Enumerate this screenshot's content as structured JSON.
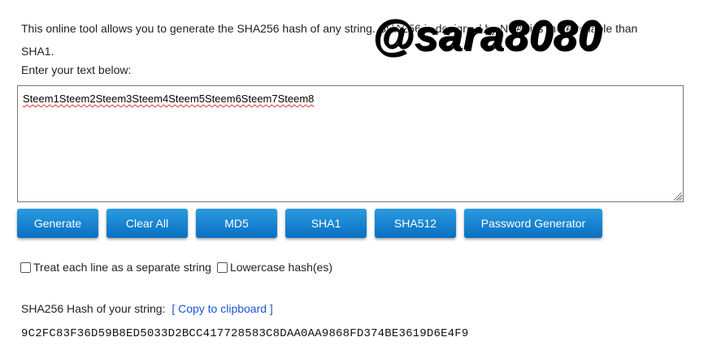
{
  "intro": {
    "text": "This online tool allows you to generate the SHA256 hash of any string. SHA256 is designed by NSA, it's more reliable than SHA1."
  },
  "input": {
    "label": "Enter your text below:",
    "value": "Steem1Steem2Steem3Steem4Steem5Steem6Steem7Steem8"
  },
  "watermark": {
    "text": "@sara8080"
  },
  "buttons": {
    "generate": "Generate",
    "clear_all": "Clear All",
    "md5": "MD5",
    "sha1": "SHA1",
    "sha512": "SHA512",
    "password_generator": "Password Generator"
  },
  "options": {
    "separate_lines": "Treat each line as a separate string",
    "lowercase": "Lowercase hash(es)"
  },
  "result": {
    "label": "SHA256 Hash of your string:",
    "copy_link": "[ Copy to clipboard ]",
    "hash": "9C2FC83F36D59B8ED5033D2BCC417728583C8DAA0AA9868FD374BE3619D6E4F9"
  },
  "colors": {
    "button": "#0a7fd0",
    "link": "#1a55d8"
  }
}
